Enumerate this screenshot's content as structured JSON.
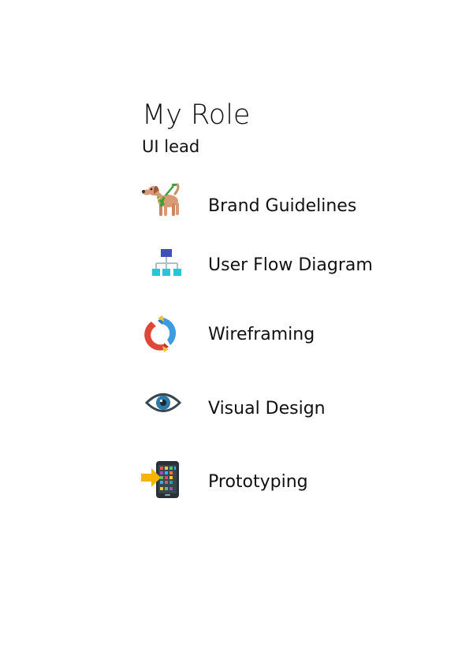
{
  "heading": {
    "title": "My Role",
    "subtitle": "UI lead"
  },
  "roles": [
    {
      "label": "Brand Guidelines",
      "icon": "guide-dog-icon"
    },
    {
      "label": "User Flow Diagram",
      "icon": "hierarchy-diagram-icon"
    },
    {
      "label": "Wireframing",
      "icon": "sync-arrows-icon"
    },
    {
      "label": "Visual Design",
      "icon": "eye-icon"
    },
    {
      "label": "Prototyping",
      "icon": "mobile-arrow-icon"
    }
  ],
  "colors": {
    "text": "#111111",
    "background": "#ffffff"
  }
}
